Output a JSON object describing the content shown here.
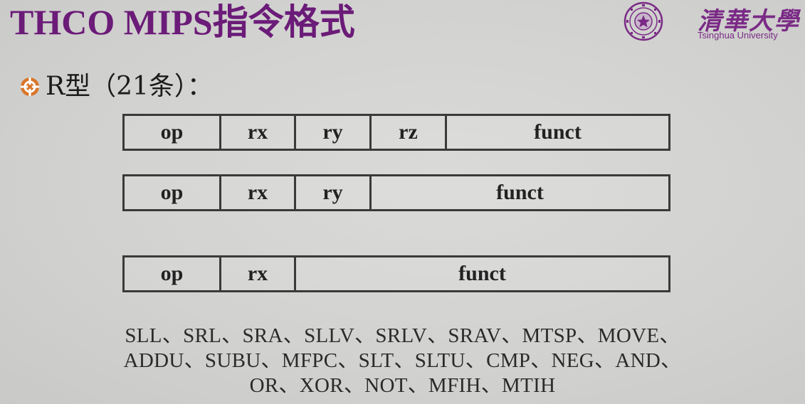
{
  "slide": {
    "title": "THCO MIPS指令格式",
    "logo": {
      "name_cn": "清華大學",
      "name_en": "Tsinghua University"
    },
    "bullet_icon": "circle-target-icon",
    "subheading": "R型（21条）："
  },
  "formats": [
    {
      "fields": [
        "op",
        "rx",
        "ry",
        "rz",
        "funct"
      ]
    },
    {
      "fields": [
        "op",
        "rx",
        "ry",
        "funct"
      ]
    },
    {
      "fields": [
        "op",
        "rx",
        "funct"
      ]
    }
  ],
  "instructions": {
    "line1": "SLL、SRL、SRA、SLLV、SRLV、SRAV、MTSP、MOVE、",
    "line2": "ADDU、SUBU、MFPC、SLT、SLTU、CMP、NEG、AND、",
    "line3": "OR、XOR、NOT、MFIH、MTIH"
  },
  "colors": {
    "title": "#6b1b78",
    "logo": "#7a2a86",
    "bullet": "#d9762b",
    "background": "#d3d3d1"
  }
}
